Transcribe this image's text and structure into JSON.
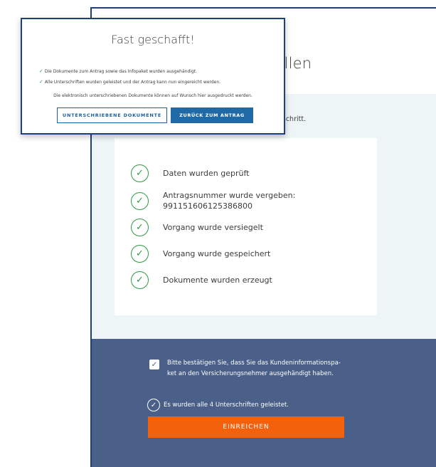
{
  "app": {
    "title": "tellen",
    "info_text": "chsten Schritt.",
    "steps": [
      {
        "icon": "check-icon",
        "text": "Daten wurden geprüft"
      },
      {
        "icon": "check-icon",
        "text": "Antragsnummer wurde vergeben:",
        "text2": "991151606125386800"
      },
      {
        "icon": "check-icon",
        "text": "Vorgang wurde versiegelt"
      },
      {
        "icon": "check-icon",
        "text": "Vorgang wurde gespeichert"
      },
      {
        "icon": "check-icon",
        "text": "Dokumente wurden erzeugt"
      }
    ],
    "confirm_line1": "Bitte bestätigen Sie, dass Sie das Kundeninformationspa-",
    "confirm_line2": "ket an den Versicherungsnehmer ausgehändigt haben.",
    "confirm_checked": true,
    "signatures_text": "Es wurden alle 4 Unterschriften geleistet.",
    "submit_label": "EINREICHEN"
  },
  "modal": {
    "title": "Fast geschafft!",
    "line1": "Die Dokumente zum Antrag sowie das Infopaket wurden ausgehändigt.",
    "line2": "Alle Unterschriften wurden geleistet und der Antrag kann nun eingereicht werden.",
    "info": "Die elektronisch unterschriebenen Dokumente können auf Wunsch hier ausgedruckt werden.",
    "btn_docs": "UNTERSCHRIEBENE DOKUMENTE",
    "btn_back": "ZURÜCK ZUM ANTRAG"
  },
  "colors": {
    "frame_border": "#1f3f7a",
    "success": "#2f9a43",
    "submit": "#f4610d",
    "bottom_band": "#4a6088",
    "primary_button": "#1f6aa6"
  }
}
